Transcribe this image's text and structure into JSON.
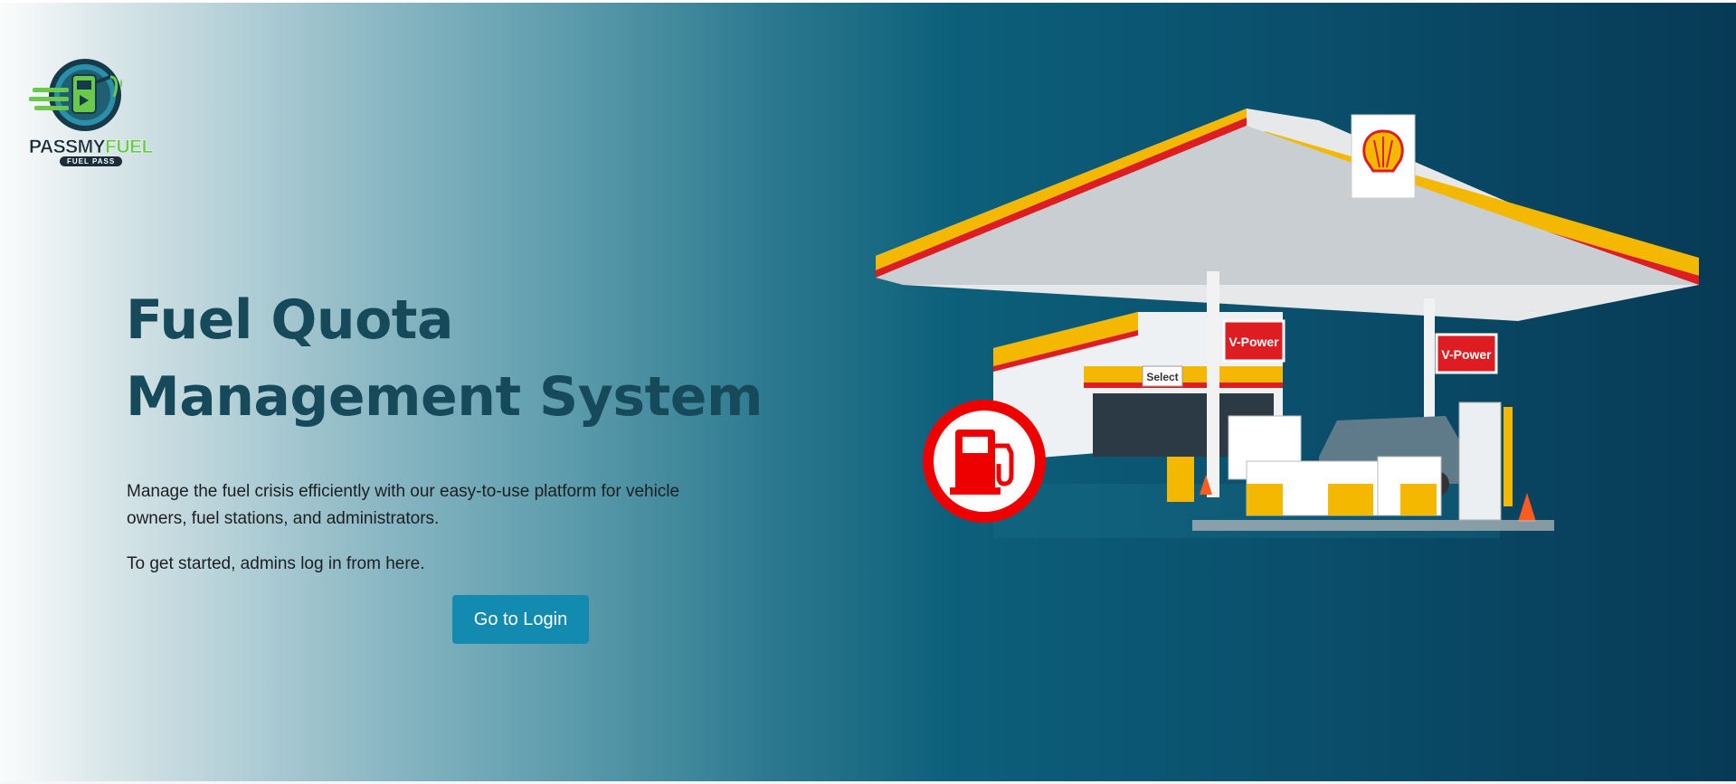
{
  "logo": {
    "word_part1": "PASSMY",
    "word_part2": "FUEL",
    "tagline": "FUEL PASS",
    "icon": "fuel-pump-logo-icon"
  },
  "hero": {
    "title_line1": "Fuel Quota",
    "title_line2": "Management System",
    "description": "Manage the fuel crisis efficiently with our easy-to-use platform for vehicle owners, fuel stations, and administrators.",
    "admin_note": "To get started, admins log in from here.",
    "login_button": "Go to Login"
  },
  "illustration": {
    "brand_logo": "shell-logo-icon",
    "canopy_sign_1": "V-Power",
    "canopy_sign_2": "V-Power",
    "store_sign": "Select",
    "badge": "fuel-pump-circle-icon"
  },
  "colors": {
    "title": "#16495a",
    "button": "#138ab0",
    "gradient_start": "#fbfcfc",
    "gradient_end": "#073a55",
    "shell_yellow": "#f5b800",
    "shell_red": "#dd1d21"
  }
}
